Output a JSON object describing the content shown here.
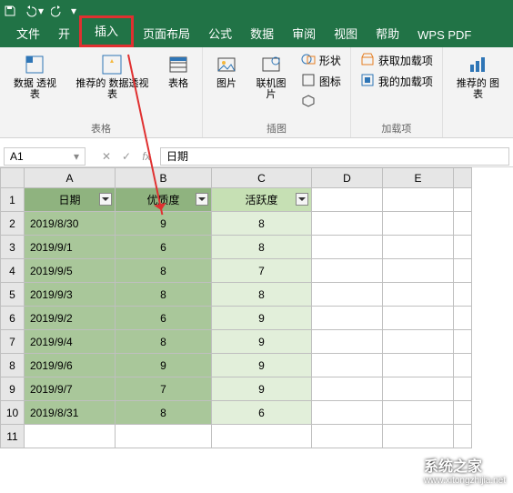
{
  "qat": {
    "save": "保存",
    "undo": "撤销",
    "redo": "重做"
  },
  "tabs": {
    "file": "文件",
    "home": "开",
    "insert": "插入",
    "layout": "页面布局",
    "formulas": "公式",
    "data": "数据",
    "review": "审阅",
    "view": "视图",
    "help": "帮助",
    "wps": "WPS PDF"
  },
  "ribbon": {
    "group_table_label": "表格",
    "group_illust_label": "插图",
    "group_addin_label": "加载项",
    "pivot": "数据\n透视表",
    "rec_pivot": "推荐的\n数据透视表",
    "table": "表格",
    "picture": "图片",
    "online_pic": "联机图片",
    "shapes": "形状",
    "icons": "图标",
    "threed": "3D",
    "get_addins": "获取加载项",
    "my_addins": "我的加载项",
    "rec_chart": "推荐的\n图表"
  },
  "namebox": "A1",
  "fx_label": "fx",
  "formula_value": "日期",
  "columns": [
    "A",
    "B",
    "C",
    "D",
    "E"
  ],
  "header": {
    "A": "日期",
    "B": "优质度",
    "C": "活跃度"
  },
  "rows": [
    {
      "A": "2019/8/30",
      "B": "9",
      "C": "8"
    },
    {
      "A": "2019/9/1",
      "B": "6",
      "C": "8"
    },
    {
      "A": "2019/9/5",
      "B": "8",
      "C": "7"
    },
    {
      "A": "2019/9/3",
      "B": "8",
      "C": "8"
    },
    {
      "A": "2019/9/2",
      "B": "6",
      "C": "9"
    },
    {
      "A": "2019/9/4",
      "B": "8",
      "C": "9"
    },
    {
      "A": "2019/9/6",
      "B": "9",
      "C": "9"
    },
    {
      "A": "2019/9/7",
      "B": "7",
      "C": "9"
    },
    {
      "A": "2019/8/31",
      "B": "8",
      "C": "6"
    }
  ],
  "watermark": {
    "title": "系统之家",
    "url": "www.xitongzhijia.net"
  }
}
